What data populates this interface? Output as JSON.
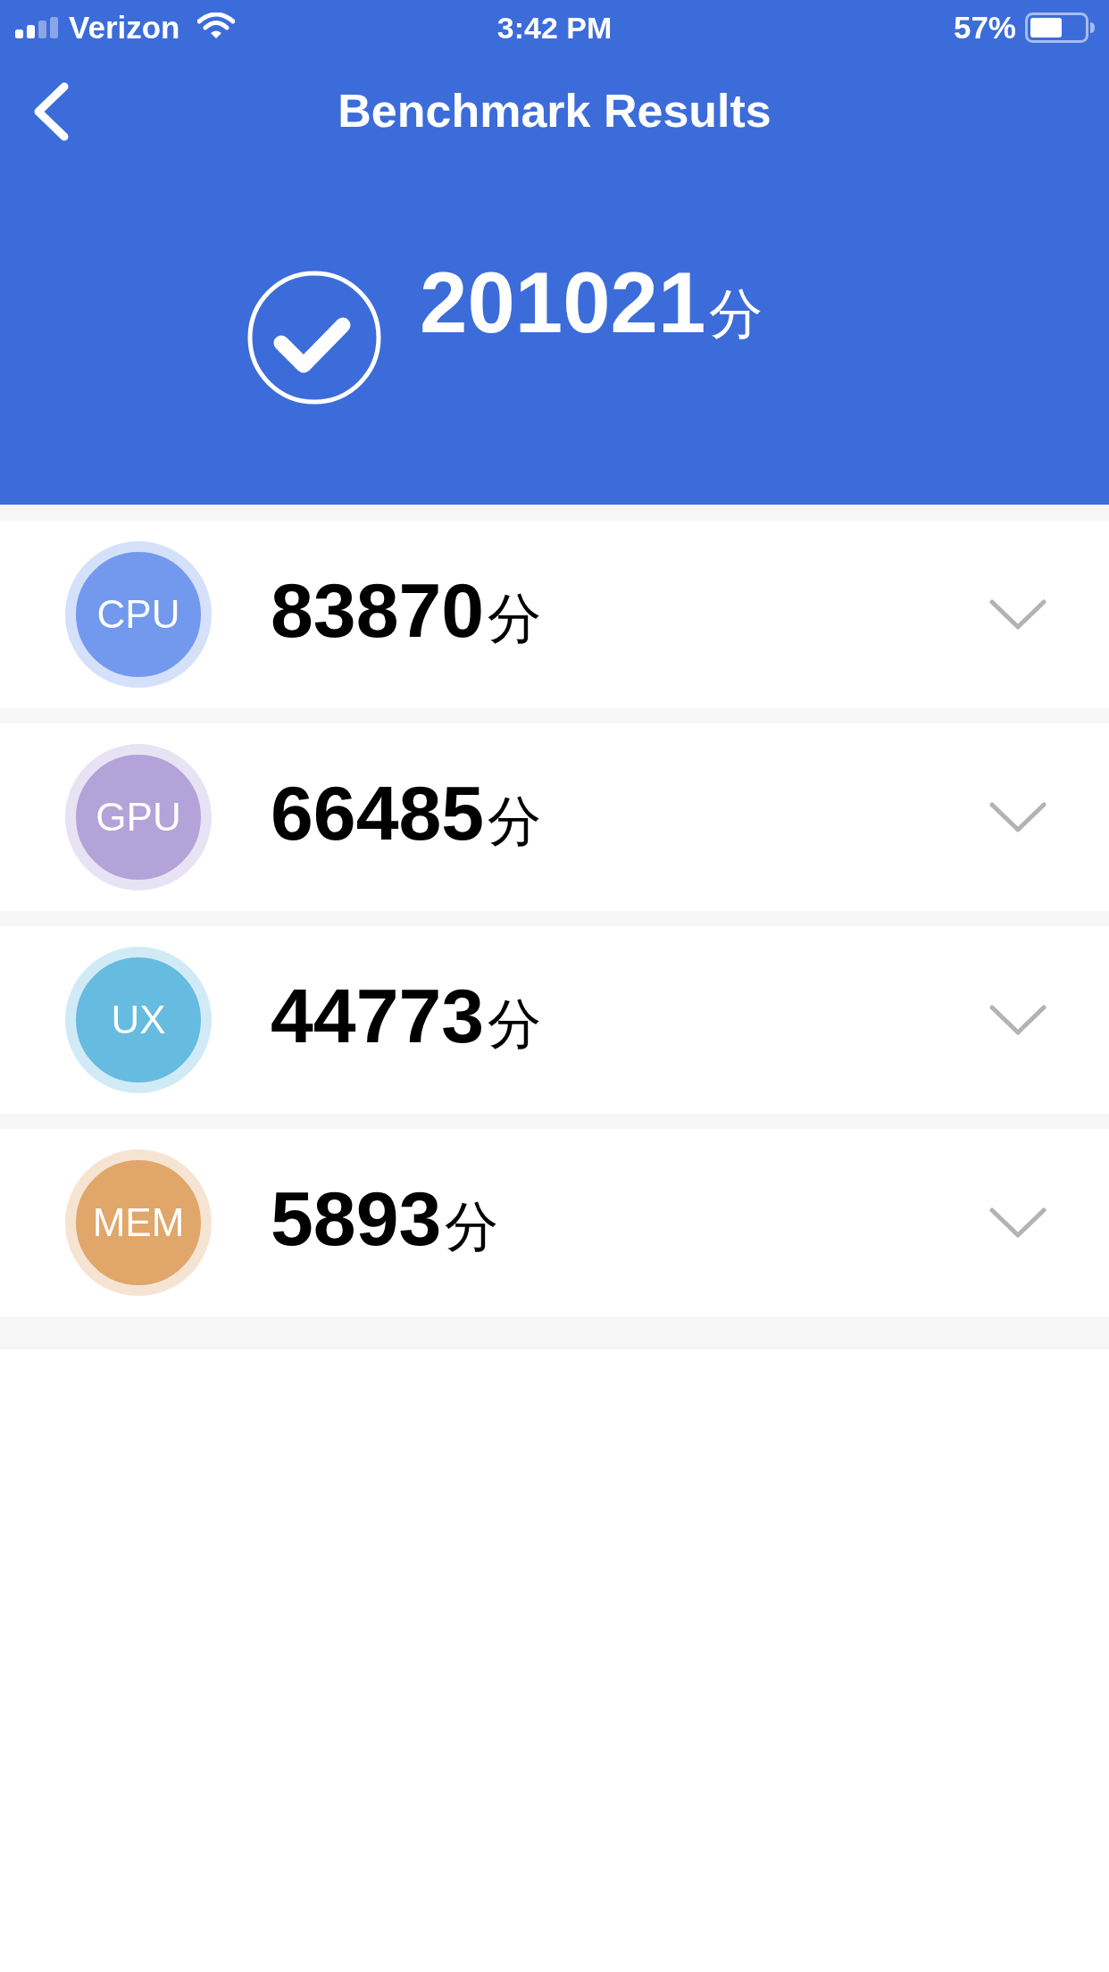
{
  "status_bar": {
    "carrier": "Verizon",
    "time": "3:42 PM",
    "battery": "57%"
  },
  "nav_bar": {
    "title": "Benchmark Results"
  },
  "total": {
    "score": "201021",
    "unit": "分"
  },
  "categories": [
    {
      "label": "CPU",
      "color": "#7399ee",
      "score": "83870",
      "unit": "分",
      "expanded": false
    },
    {
      "label": "GPU",
      "color": "#b3a3d9",
      "score": "66485",
      "unit": "分",
      "expanded": false
    },
    {
      "label": "UX",
      "color": "#66bbe0",
      "score": "44773",
      "unit": "分",
      "expanded": false
    },
    {
      "label": "MEM",
      "color": "#e0a66a",
      "score": "5893",
      "unit": "分",
      "expanded": false
    }
  ]
}
